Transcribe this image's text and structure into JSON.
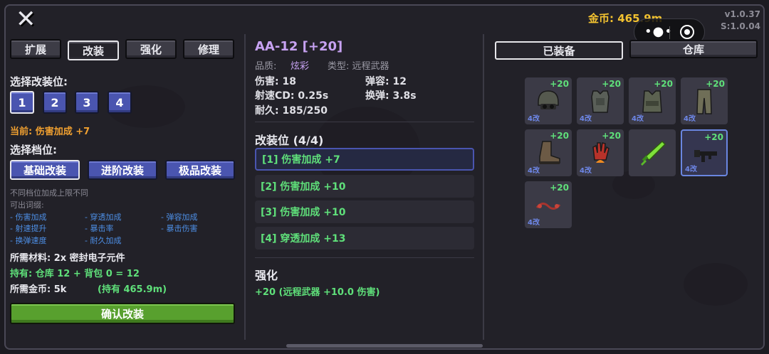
{
  "header": {
    "gold_label": "金币: 465.9m",
    "version": "v1.0.37",
    "server_version": "S:1.0.04"
  },
  "left": {
    "tabs": [
      "扩展",
      "改装",
      "强化",
      "修理"
    ],
    "active_tab": 1,
    "select_slot_label": "选择改装位:",
    "slots": [
      "1",
      "2",
      "3",
      "4"
    ],
    "current_label": "当前: 伤害加成 +7",
    "select_tier_label": "选择档位:",
    "tiers": [
      "基础改装",
      "进阶改装",
      "极品改装"
    ],
    "tier_note": "不同档位加成上限不同",
    "affix_title": "可出词缀:",
    "affixes": [
      "- 伤害加成",
      "- 穿透加成",
      "- 弹容加成",
      "- 射速提升",
      "- 暴击率",
      "- 暴击伤害",
      "- 换弹速度",
      "- 耐久加成"
    ],
    "material_label": "所需材料: 2x 密封电子元件",
    "owned_label": "持有: 仓库 12 + 背包 0 = 12",
    "gold_cost_label": "所需金币: 5k",
    "gold_owned_label": "(持有 465.9m)",
    "confirm_label": "确认改装"
  },
  "middle": {
    "item_title": "AA-12 [+20]",
    "quality_key": "品质:",
    "quality_value": "炫彩",
    "type_label": "类型: 远程武器",
    "damage": "伤害: 18",
    "capacity": "弹容: 12",
    "fire_cd": "射速CD: 0.25s",
    "reload": "换弹: 3.8s",
    "durability": "耐久: 185/250",
    "mod_section_title": "改装位 (4/4)",
    "mod_slots": [
      "[1] 伤害加成 +7",
      "[2] 伤害加成 +10",
      "[3] 伤害加成 +10",
      "[4] 穿透加成 +13"
    ],
    "enhance_title": "强化",
    "enhance_value": "+20 (远程武器 +10.0 伤害)"
  },
  "right": {
    "tabs": [
      "已装备",
      "仓库"
    ],
    "items": [
      {
        "icon": "helmet-icon",
        "plus": "+20",
        "mods": "4改"
      },
      {
        "icon": "body-armor-icon",
        "plus": "+20",
        "mods": "4改"
      },
      {
        "icon": "tactical-vest-icon",
        "plus": "+20",
        "mods": "4改"
      },
      {
        "icon": "pants-icon",
        "plus": "+20",
        "mods": "4改"
      },
      {
        "icon": "boots-icon",
        "plus": "+20",
        "mods": "4改"
      },
      {
        "icon": "gloves-icon",
        "plus": "+20",
        "mods": "4改"
      },
      {
        "icon": "green-sword-icon",
        "plus": "",
        "mods": ""
      },
      {
        "icon": "shotgun-icon",
        "plus": "+20",
        "mods": "4改"
      },
      {
        "icon": "necklace-icon",
        "plus": "+20",
        "mods": "4改"
      }
    ]
  },
  "colors": {
    "accent_blue": "#4a55b0",
    "green": "#5fe07a",
    "gold": "#f3c230",
    "orange": "#f0a030",
    "purple": "#c7a2f2"
  }
}
